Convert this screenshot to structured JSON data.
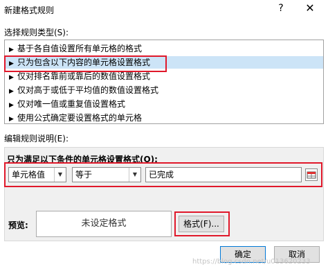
{
  "window": {
    "title": "新建格式规则",
    "help": "?",
    "close": "✕"
  },
  "rule_type": {
    "label": "选择规则类型(S):",
    "items": [
      "基于各自值设置所有单元格的格式",
      "只为包含以下内容的单元格设置格式",
      "仅对排名靠前或靠后的数值设置格式",
      "仅对高于或低于平均值的数值设置格式",
      "仅对唯一值或重复值设置格式",
      "使用公式确定要设置格式的单元格"
    ],
    "selected_index": 1,
    "arrow": "▶"
  },
  "edit": {
    "label": "编辑规则说明(E):",
    "condition_label": "只为满足以下条件的单元格设置格式(O):",
    "dropdown1": "单元格值",
    "dropdown2": "等于",
    "value": "已完成"
  },
  "preview": {
    "label": "预览:",
    "text": "未设定格式"
  },
  "buttons": {
    "format": "格式(F)...",
    "ok": "确定",
    "cancel": "取消"
  },
  "watermark": "https://blog.csdn.net/u013620233",
  "colors": {
    "highlight": "#e0182a",
    "selection": "#cce4f7"
  }
}
